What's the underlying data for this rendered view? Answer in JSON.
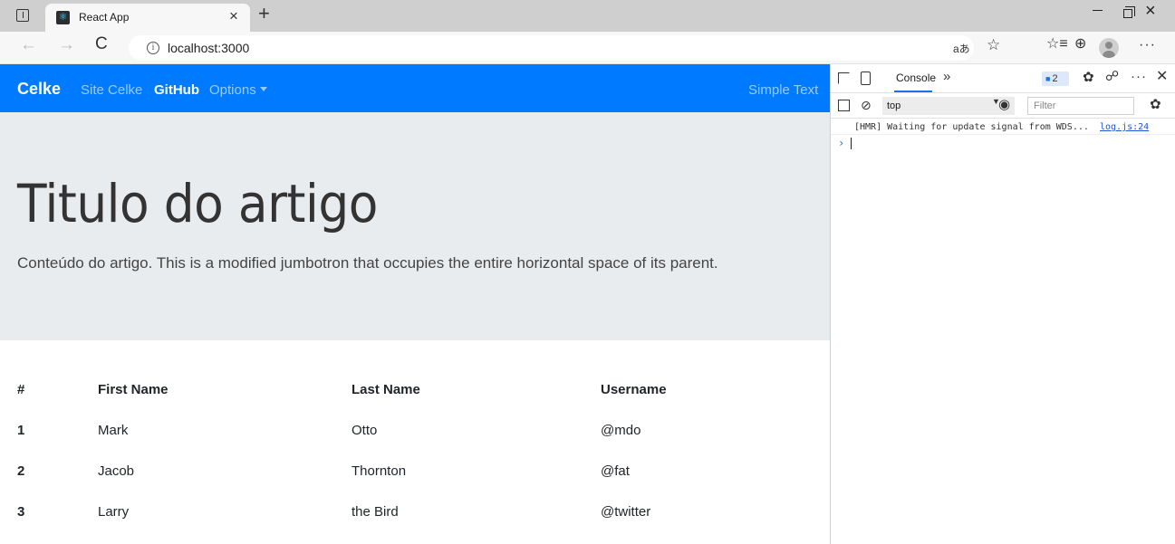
{
  "browser": {
    "tab_title": "React App",
    "tab_close": "×",
    "new_tab": "+",
    "favicon_glyph": "⚛",
    "window_close": "×",
    "url": "localhost:3000",
    "read_aloud_label": "aあ",
    "nav_back": "←",
    "nav_forward": "→",
    "reload": "C",
    "info_glyph": "i",
    "favorites_star": "☆",
    "favorites_bar": "☆≡",
    "collections": "⊕",
    "more": "···"
  },
  "page": {
    "navbar": {
      "brand": "Celke",
      "links": [
        "Site Celke",
        "GitHub",
        "Options"
      ],
      "right_text": "Simple Text",
      "color": "#007bff"
    },
    "jumbotron": {
      "title": "Titulo do artigo",
      "lead": "Conteúdo do artigo. This is a modified jumbotron that occupies the entire horizontal space of its parent."
    },
    "table": {
      "headers": [
        "#",
        "First Name",
        "Last Name",
        "Username"
      ],
      "rows": [
        [
          "1",
          "Mark",
          "Otto",
          "@mdo"
        ],
        [
          "2",
          "Jacob",
          "Thornton",
          "@fat"
        ],
        [
          "3",
          "Larry",
          "the Bird",
          "@twitter"
        ]
      ]
    }
  },
  "devtools": {
    "tab_console": "Console",
    "more_tabs": "»",
    "issues_count": "2",
    "context": "top",
    "filter_placeholder": "Filter",
    "log": {
      "text": "[HMR] Waiting for update signal from WDS...",
      "source": "log.js:24"
    },
    "prompt": "›",
    "icons": {
      "settings": "✿",
      "kebab": "···",
      "close": "✕",
      "clear": "⊘",
      "eye": "◉",
      "connect": "☍"
    }
  }
}
